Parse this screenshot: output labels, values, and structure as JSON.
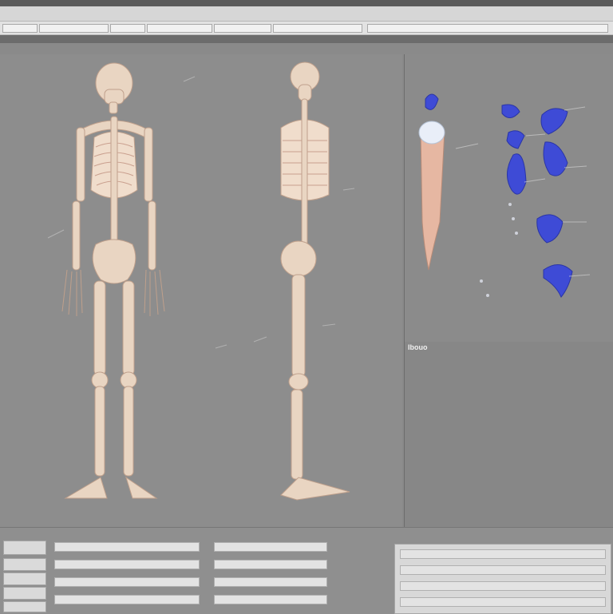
{
  "header": {
    "title_left": "",
    "title_mid": "",
    "tool_labels": [
      "",
      "",
      "",
      "",
      "",
      "",
      "",
      ""
    ]
  },
  "viewport": {
    "front_view_label": "",
    "side_view_label": ""
  },
  "right_panel": {
    "title": "",
    "col1": "",
    "col2": "",
    "col3": "",
    "annotations": [
      "",
      "",
      "",
      "",
      "",
      ""
    ]
  },
  "lower_panel": {
    "title": "Ibouo"
  },
  "bottom": {
    "section1": "",
    "section2": "",
    "section3": "",
    "section4": "",
    "rows_left": [
      "",
      "",
      "",
      ""
    ],
    "rows_right": [
      "",
      "",
      "",
      ""
    ]
  },
  "colors": {
    "bone": "#e8d2bf",
    "accent_blue": "#3e4bd6",
    "panel": "#8d8d8d"
  }
}
